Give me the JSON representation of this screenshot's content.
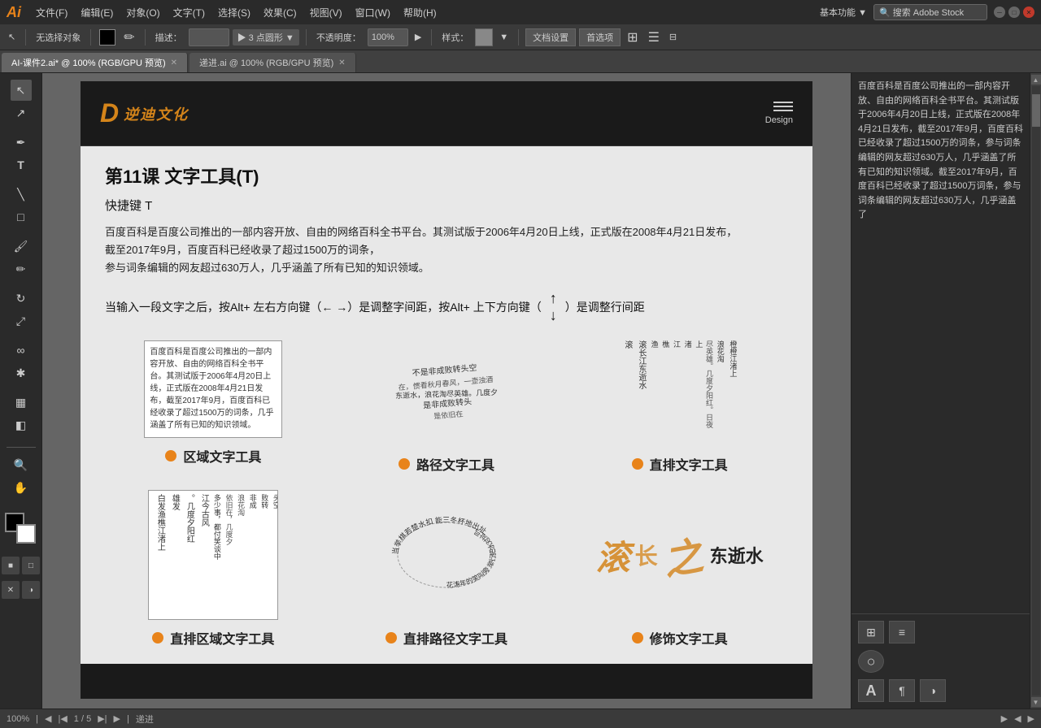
{
  "app": {
    "icon": "Ai",
    "icon_color": "#e8831a"
  },
  "menu": {
    "items": [
      "文件(F)",
      "编辑(E)",
      "对象(O)",
      "文字(T)",
      "选择(S)",
      "效果(C)",
      "视图(V)",
      "窗口(W)",
      "帮助(H)"
    ]
  },
  "toolbar": {
    "no_selection": "无选择对象",
    "blend_label": "描述：",
    "points_label": "▶ 3 点圆形 ▼",
    "opacity_label": "不透明度：",
    "opacity_value": "100%",
    "style_label": "样式：",
    "doc_settings": "文档设置",
    "preferences": "首选项"
  },
  "tabs": [
    {
      "label": "AI-课件2.ai* @ 100% (RGB/GPU 预览)",
      "active": true
    },
    {
      "label": "递进.ai @ 100% (RGB/GPU 预览)",
      "active": false
    }
  ],
  "right_panel": {
    "text": "百度百科是百度公司推出的一部内容开放、自由的网络百科全书平台。其测试版于2006年4月20日上线，正式版在2008年4月21日发布，截至2017年9月，百度百科已经收录了超过1500万的词条，参与词条编辑的网友超过630万人，几乎涵盖了所有已知的知识领域。截至2017年9月，百度百科已经收录了超过1500万词条，参与词条编辑的网友超过630万人，几乎涵盖了"
  },
  "document": {
    "logo_d": "D",
    "logo_text": "逆迪文化",
    "menu_label": "Design",
    "lesson_title": "第11课   文字工具(T)",
    "shortcut": "快捷键 T",
    "desc1": "百度百科是百度公司推出的一部内容开放、自由的网络百科全书平台。其测试版于2006年4月20日上线，正式版在2008年4月21日发布，",
    "desc2": "截至2017年9月，百度百科已经收录了超过1500万的词条，",
    "desc3": "参与词条编辑的网友超过630万人，几乎涵盖了所有已知的知识领域。",
    "key_instruction": "当输入一段文字之后，按Alt+ 左右方向键（← →）是调整字间距，按Alt+ 上下方向键（",
    "key_instruction2": "）是调整行间距",
    "demo": {
      "area_text_label": "区域文字工具",
      "path_text_label": "路径文字工具",
      "vertical_text_label": "直排文字工具",
      "vertical_area_label": "直排区域文字工具",
      "vertical_path_label": "直排路径文字工具",
      "decor_text_label": "修饰文字工具",
      "area_content": "百度百科是百度公司推出的一部内容开放、自由的网络百科全书平台。其测试版于2006年4月20日上线，正式版在2008年4月21日发布，截至2017年9月，百度百科已经收录了超过1500万的词条，几乎涵盖了所有已知的知识领域。",
      "path_poem_lines": [
        "是非成败转头空",
        "青山依旧在，情看秋月春风，一壶浊酒，古今多少事，都付笑谈中，滚滚长江东逝水，浪花淘尽英雄。几度夕阳红。日夜渔樵江渚上，惯看秋月春",
        "是非成败转头空",
        "是依旧在"
      ],
      "vertical_poem": [
        "旧是",
        "是非",
        "在成",
        "几败",
        "度转",
        "夕头",
        "阳空",
        "红，",
        "日青",
        "夜山",
        "渔依",
        "樵旧",
        "江在",
        "渚，",
        "上一",
        "，壶",
        "惯浊",
        "看酒",
        "秋，",
        "月古",
        "春今",
        "风多",
        "，少",
        "一事",
        "壶，",
        "浊都",
        "酒付",
        "，笑",
        "古谈",
        "今中"
      ]
    }
  },
  "status": {
    "zoom": "100%",
    "pages": "1",
    "page_current": "5",
    "artboard": "递进"
  }
}
